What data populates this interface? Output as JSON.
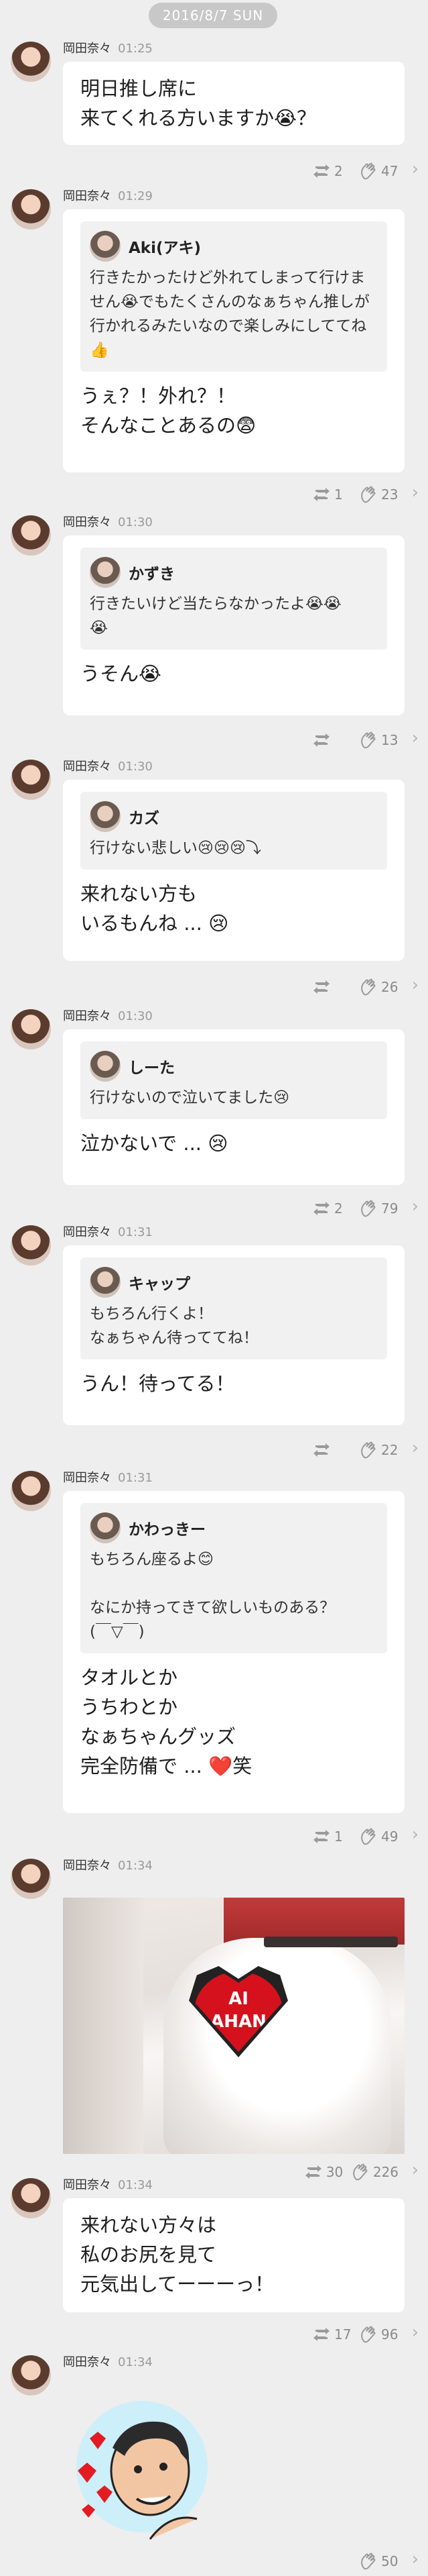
{
  "date": "2016/8/7 SUN",
  "sender": "岡田奈々",
  "messages": [
    {
      "time": "01:25",
      "text": "明日推し席に\n来てくれる方いますか😭？",
      "retweets": "2",
      "claps": "47"
    },
    {
      "time": "01:29",
      "quote_user": "Aki(アキ)",
      "quote_text": "行きたかったけど外れてしまって行けません😭でもたくさんのなぁちゃん推しが行かれるみたいなので楽しみにしててね👍",
      "reply": "うぇ？！外れ？！\nそんなことあるの😨",
      "retweets": "1",
      "claps": "23"
    },
    {
      "time": "01:30",
      "quote_user": "かずき",
      "quote_text": "行きたいけど当たらなかったよ😭😭\n😭",
      "reply": "うそん😭",
      "retweets": "",
      "claps": "13"
    },
    {
      "time": "01:30",
      "quote_user": "カズ",
      "quote_text": "行けない悲しい😢😢😢⤵",
      "reply": "来れない方も\nいるもんね ... 😢",
      "retweets": "",
      "claps": "26"
    },
    {
      "time": "01:30",
      "quote_user": "しーた",
      "quote_text": "行けないので泣いてました😢",
      "reply": "泣かないで ... 😢",
      "retweets": "2",
      "claps": "79"
    },
    {
      "time": "01:31",
      "quote_user": "キャップ",
      "quote_text": "もちろん行くよ！\nなぁちゃん待っててね！",
      "reply": "うん！待ってる！",
      "retweets": "",
      "claps": "22"
    },
    {
      "time": "01:31",
      "quote_user": "かわっきー",
      "quote_text": "もちろん座るよ😊\n\nなにか持ってきて欲しいものある？\n(￣▽￣)",
      "reply": "タオルとか\nうちわとか\nなぁちゃんグッズ\n完全防備で ... ❤️笑",
      "retweets": "1",
      "claps": "49"
    },
    {
      "time": "01:34",
      "photo_text": "AI\nAHAN",
      "retweets": "30",
      "claps": "226"
    },
    {
      "time": "01:34",
      "text": "来れない方々は\n私のお尻を見て\n元気出してーーーっ！",
      "retweets": "17",
      "claps": "96"
    },
    {
      "time": "01:34",
      "sticker": "heart-sticker",
      "retweets": "",
      "claps": "50"
    }
  ],
  "icons": {
    "retweet": "retweet-icon",
    "clap": "clap-icon",
    "chevron": "chevron-right-icon"
  }
}
